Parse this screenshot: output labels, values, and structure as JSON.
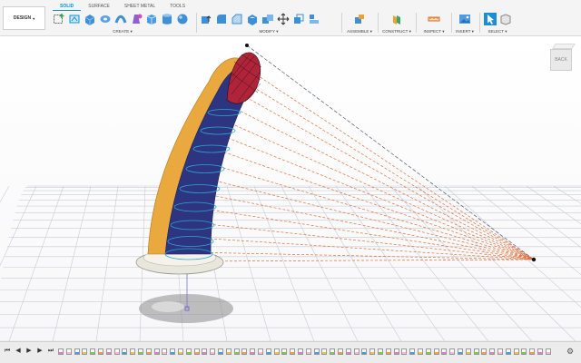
{
  "workspace": {
    "label": "DESIGN",
    "caret": "▾"
  },
  "tabs": [
    {
      "label": "SOLID",
      "active": true
    },
    {
      "label": "SURFACE",
      "active": false
    },
    {
      "label": "SHEET METAL",
      "active": false
    },
    {
      "label": "TOOLS",
      "active": false
    }
  ],
  "groups": {
    "create": "CREATE ▾",
    "modify": "MODIFY ▾",
    "assemble": "ASSEMBLE ▾",
    "construct": "CONSTRUCT ▾",
    "inspect": "INSPECT ▾",
    "insert": "INSERT ▾",
    "select": "SELECT ▾"
  },
  "icons": {
    "create": [
      "new-component-icon",
      "create-sketch-icon",
      "extrude-icon",
      "revolve-icon",
      "sweep-icon",
      "loft-icon",
      "box-icon",
      "cylinder-icon",
      "sphere-icon"
    ],
    "modify": [
      "press-pull-icon",
      "fillet-icon",
      "chamfer-icon",
      "shell-icon",
      "combine-icon",
      "move-icon",
      "scale-icon",
      "align-icon"
    ],
    "assemble": [
      "joint-icon"
    ],
    "construct": [
      "offset-plane-icon"
    ],
    "inspect": [
      "measure-icon"
    ],
    "insert": [
      "insert-image-icon"
    ],
    "select": [
      "select-cursor-icon",
      "selection-filter-icon"
    ]
  },
  "viewcube": {
    "face": "BACK"
  },
  "timeline": {
    "controls": [
      "⏮",
      "◀",
      "▶",
      "▶",
      "⏭"
    ],
    "settings_icon": "⚙",
    "item_colors": [
      "#e07acb",
      "#f5b6d8",
      "#3aa0e0",
      "#f0c040",
      "#7ac943",
      "#ff9a3c"
    ]
  },
  "colors": {
    "accent": "#0696d7",
    "body_yellow": "#e9a93f",
    "body_navy": "#2e3580",
    "tip_red": "#b0243a",
    "lines_orange": "#e0703a",
    "grid": "#c7c9d3"
  }
}
